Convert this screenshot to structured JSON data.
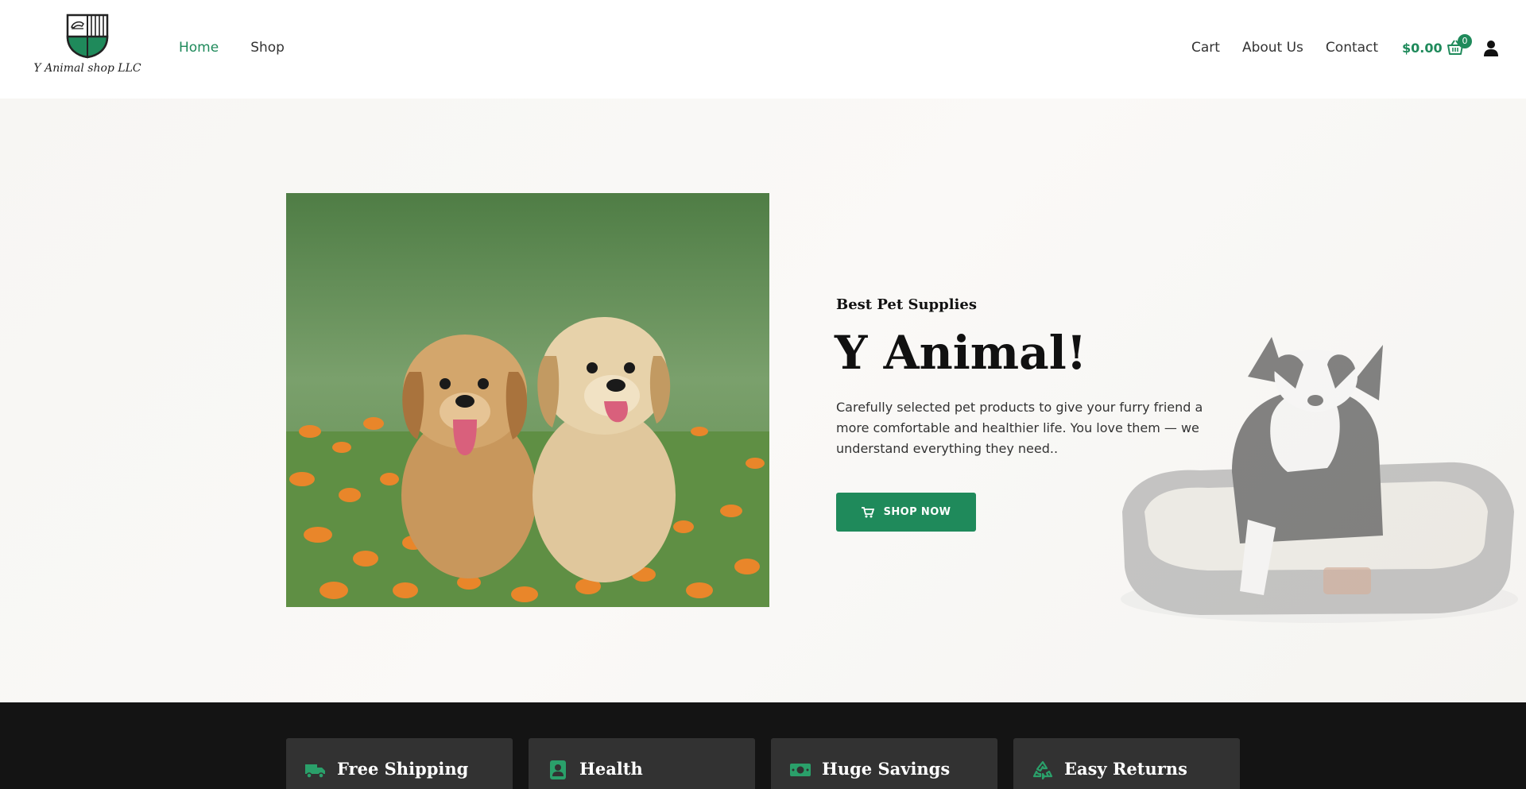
{
  "brand": {
    "logo_text": "Y Animal shop LLC"
  },
  "nav": {
    "left": [
      {
        "label": "Home",
        "active": true
      },
      {
        "label": "Shop",
        "active": false
      }
    ],
    "right": [
      {
        "label": "Cart"
      },
      {
        "label": "About Us"
      },
      {
        "label": "Contact"
      }
    ]
  },
  "cart": {
    "total": "$0.00",
    "count": "0"
  },
  "hero": {
    "kicker": "Best Pet Supplies",
    "title": "Y Animal!",
    "text": "Carefully selected pet products to give your furry friend a more comfortable and healthier life. You love them — we understand everything they need..",
    "button_label": "SHOP NOW"
  },
  "features": [
    {
      "title": "Free Shipping",
      "icon": "truck-icon"
    },
    {
      "title": "Health",
      "icon": "health-card-icon"
    },
    {
      "title": "Huge Savings",
      "icon": "money-icon"
    },
    {
      "title": "Easy Returns",
      "icon": "recycle-icon"
    }
  ],
  "colors": {
    "accent": "#1f8a5b",
    "dark": "#141414",
    "card": "#323232"
  }
}
